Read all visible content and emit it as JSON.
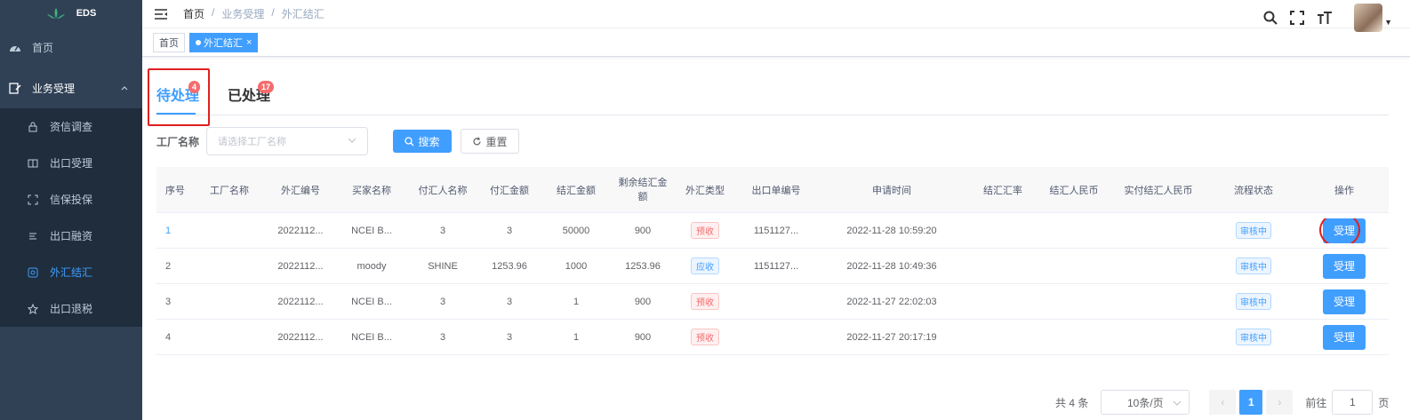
{
  "app": {
    "name": "EDS"
  },
  "sidebar": {
    "items": [
      {
        "label": "首页"
      },
      {
        "label": "业务受理"
      },
      {
        "label": "资信调查"
      },
      {
        "label": "出口受理"
      },
      {
        "label": "信保投保"
      },
      {
        "label": "出口融资"
      },
      {
        "label": "外汇结汇"
      },
      {
        "label": "出口退税"
      }
    ]
  },
  "breadcrumb": {
    "home": "首页",
    "sep": "/",
    "level1": "业务受理",
    "level2": "外汇结汇"
  },
  "tags": {
    "home": "首页",
    "active": "外汇结汇",
    "close": "×"
  },
  "tabs": [
    {
      "label": "待处理",
      "badge": "4"
    },
    {
      "label": "已处理",
      "badge": "17"
    }
  ],
  "filter": {
    "label": "工厂名称",
    "placeholder": "请选择工厂名称",
    "search": "搜索",
    "reset": "重置"
  },
  "table": {
    "headers": [
      "序号",
      "工厂名称",
      "外汇编号",
      "买家名称",
      "付汇人名称",
      "付汇金额",
      "结汇金额",
      "剩余结汇金额",
      "外汇类型",
      "出口单编号",
      "申请时间",
      "结汇汇率",
      "结汇人民币",
      "实付结汇人民币",
      "流程状态",
      "操作"
    ],
    "rows": [
      {
        "seq": "1",
        "factory": "",
        "fx_no": "2022112...",
        "buyer": "NCEI B...",
        "payer": "3",
        "pay_amt": "3",
        "settle_amt": "50000",
        "remain": "900",
        "type": "预收",
        "export_no": "1151127...",
        "time": "2022-11-28 10:59:20",
        "rate": "",
        "rmb": "",
        "paid_rmb": "",
        "status": "审核中",
        "action": "受理"
      },
      {
        "seq": "2",
        "factory": "",
        "fx_no": "2022112...",
        "buyer": "moody",
        "payer": "SHINE",
        "pay_amt": "1253.96",
        "settle_amt": "1000",
        "remain": "1253.96",
        "type": "应收",
        "export_no": "1151127...",
        "time": "2022-11-28 10:49:36",
        "rate": "",
        "rmb": "",
        "paid_rmb": "",
        "status": "审核中",
        "action": "受理"
      },
      {
        "seq": "3",
        "factory": "",
        "fx_no": "2022112...",
        "buyer": "NCEI B...",
        "payer": "3",
        "pay_amt": "3",
        "settle_amt": "1",
        "remain": "900",
        "type": "预收",
        "export_no": "",
        "time": "2022-11-27 22:02:03",
        "rate": "",
        "rmb": "",
        "paid_rmb": "",
        "status": "审核中",
        "action": "受理"
      },
      {
        "seq": "4",
        "factory": "",
        "fx_no": "2022112...",
        "buyer": "NCEI B...",
        "payer": "3",
        "pay_amt": "3",
        "settle_amt": "1",
        "remain": "900",
        "type": "预收",
        "export_no": "",
        "time": "2022-11-27 20:17:19",
        "rate": "",
        "rmb": "",
        "paid_rmb": "",
        "status": "审核中",
        "action": "受理"
      }
    ]
  },
  "pagination": {
    "total": "共 4 条",
    "page_size": "10条/页",
    "current": "1",
    "goto": "前往",
    "goto_value": "1",
    "page_unit": "页",
    "prev": "‹",
    "next": "›"
  },
  "colors": {
    "primary": "#409eff",
    "sidebar_bg": "#304156",
    "danger": "#f56c6c"
  }
}
